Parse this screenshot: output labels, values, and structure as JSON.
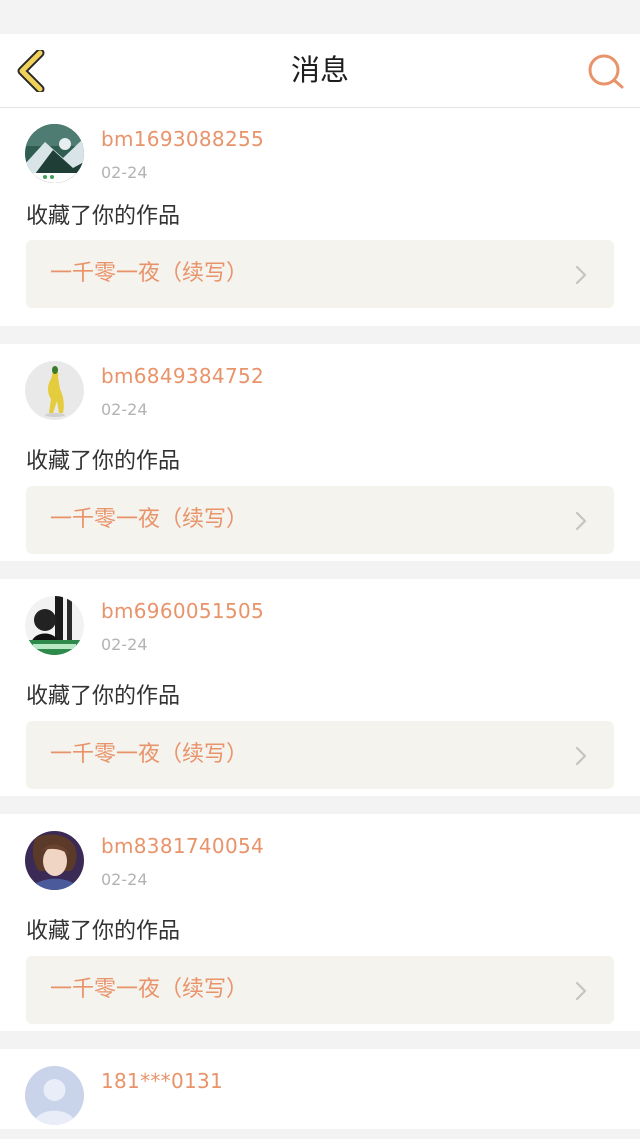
{
  "header": {
    "title": "消息",
    "back_icon": "chevron-left-icon",
    "search_icon": "search-icon"
  },
  "colors": {
    "accent": "#e9936a",
    "back_icon_fill": "#f0d25a",
    "page_bg": "#f4f3f3",
    "card_bg": "#ffffff",
    "work_box_bg": "#f4f3ed"
  },
  "messages": [
    {
      "username": "bm1693088255",
      "date": "02-24",
      "action": "收藏了你的作品",
      "work_title": "一千零一夜（续写）"
    },
    {
      "username": "bm6849384752",
      "date": "02-24",
      "action": "收藏了你的作品",
      "work_title": "一千零一夜（续写）"
    },
    {
      "username": "bm6960051505",
      "date": "02-24",
      "action": "收藏了你的作品",
      "work_title": "一千零一夜（续写）"
    },
    {
      "username": "bm8381740054",
      "date": "02-24",
      "action": "收藏了你的作品",
      "work_title": "一千零一夜（续写）"
    },
    {
      "username": "181***0131"
    }
  ]
}
